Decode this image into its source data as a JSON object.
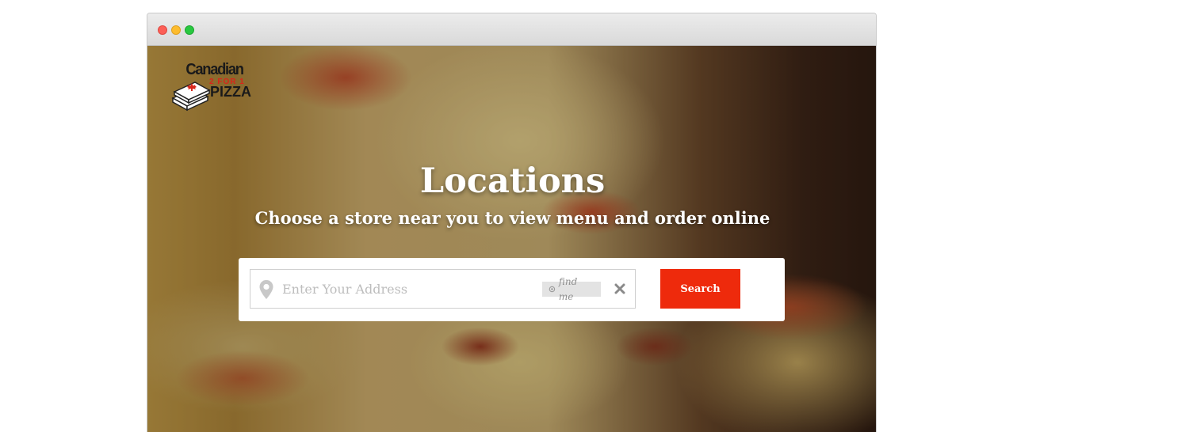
{
  "window": {
    "controls": [
      "close",
      "minimize",
      "maximize"
    ]
  },
  "brand": {
    "logo_name": "Canadian 2 For 1 Pizza",
    "logo_line1": "Canadian",
    "logo_line2": "2 FOR 1",
    "logo_line3": "PIZZA",
    "accent_color": "#ee2a0c"
  },
  "hero": {
    "title": "Locations",
    "subtitle": "Choose a store near you to view menu and order online"
  },
  "search": {
    "placeholder": "Enter Your Address",
    "value": "",
    "find_me_label": "find me",
    "clear_icon": "close-icon",
    "location_icon": "map-pin-icon",
    "button_label": "Search"
  }
}
